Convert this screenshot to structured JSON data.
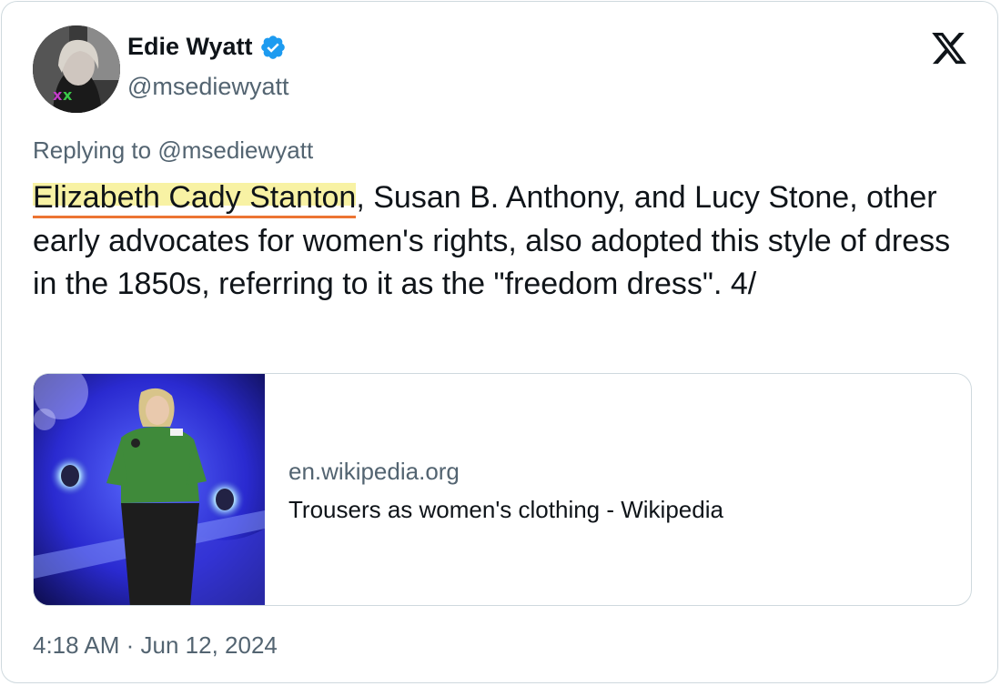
{
  "author": {
    "display_name": "Edie Wyatt",
    "handle": "@msediewyatt",
    "avatar_icon": "profile-photo"
  },
  "platform_icon": "x-logo-icon",
  "reply": {
    "prefix": "Replying to ",
    "target": "@msediewyatt"
  },
  "tweet": {
    "highlighted_text": "Elizabeth Cady Stanton",
    "rest_text": ", Susan B. Anthony, and Lucy Stone, other early advocates for women's rights, also adopted this style of dress in the 1850s, referring to it as the \"freedom dress\". 4/"
  },
  "link_card": {
    "domain": "en.wikipedia.org",
    "title": "Trousers as women's clothing - Wikipedia"
  },
  "meta": {
    "time": "4:18 AM",
    "separator": " · ",
    "date": "Jun 12, 2024"
  },
  "colors": {
    "verified": "#1d9bf0",
    "highlight": "#f8f2a4",
    "underline": "#ec7433",
    "muted_text": "#536471",
    "main_text": "#0f1419",
    "border": "#cfd9de"
  }
}
